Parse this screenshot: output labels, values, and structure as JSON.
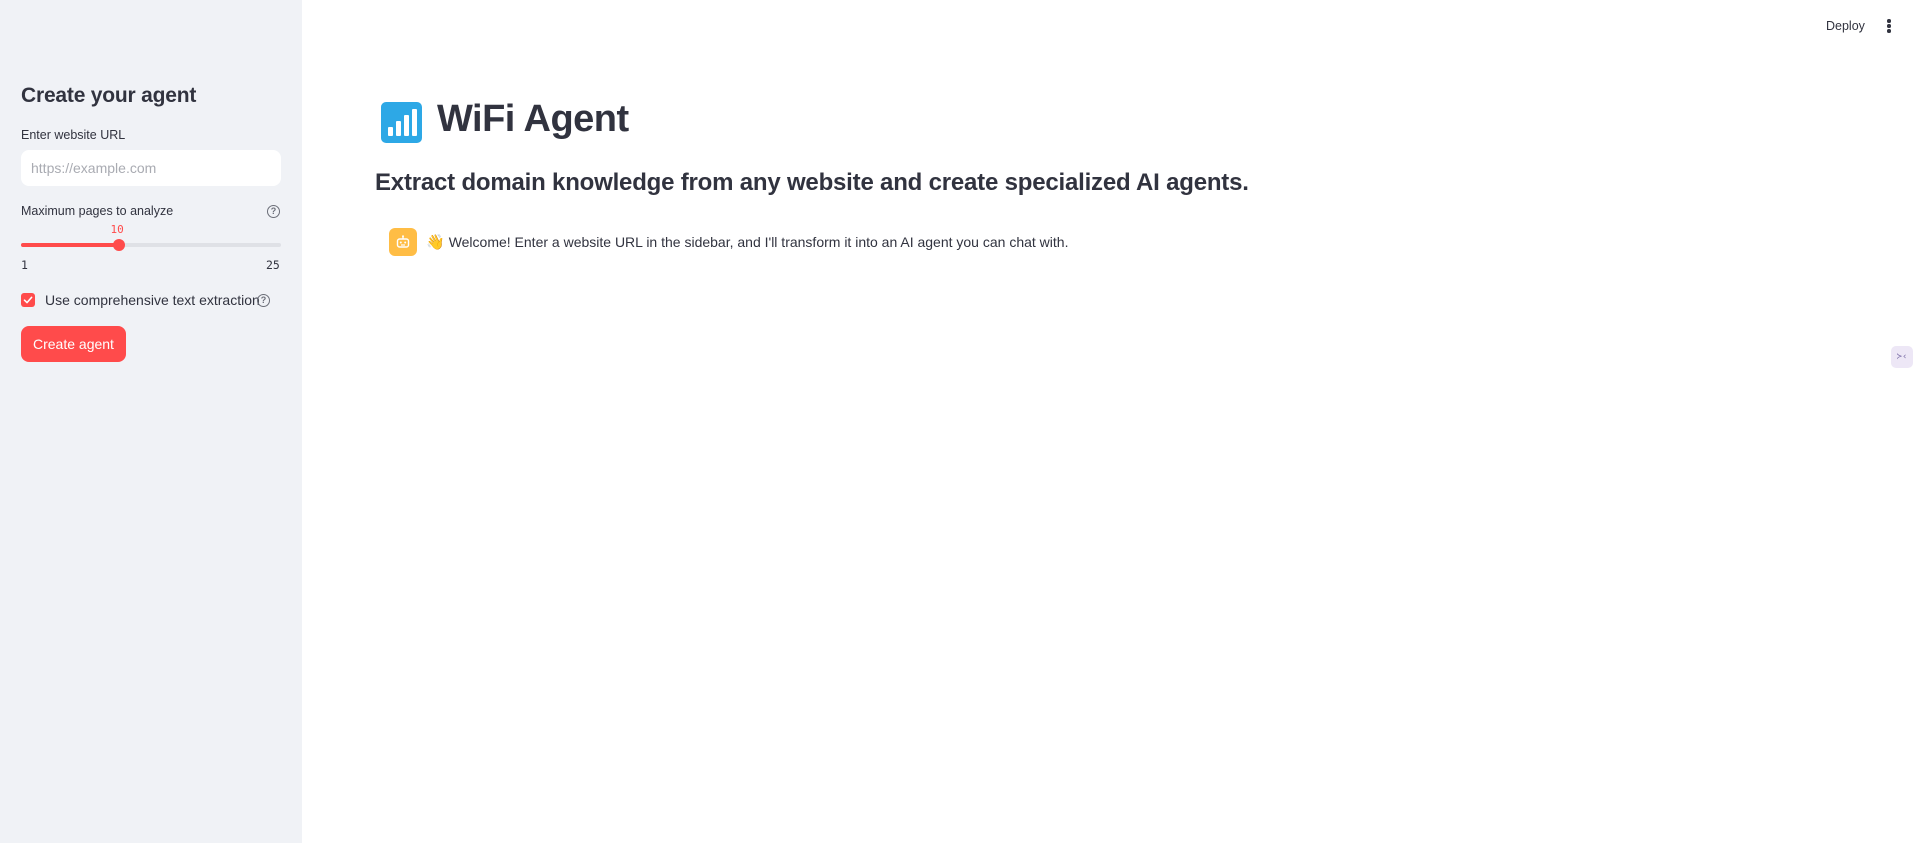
{
  "sidebar": {
    "title": "Create your agent",
    "url_label": "Enter website URL",
    "url_value": "",
    "url_placeholder": "https://example.com",
    "slider_label": "Maximum pages to analyze",
    "slider_value": "10",
    "slider_min": "1",
    "slider_max": "25",
    "checkbox_label": "Use comprehensive text extraction",
    "checkbox_checked": true,
    "create_button": "Create agent",
    "help_icon": "help-circle-icon"
  },
  "header": {
    "deploy_label": "Deploy",
    "menu_icon": "kebab-menu-icon"
  },
  "main": {
    "app_icon": "signal-bars-icon",
    "title": "WiFi Agent",
    "subtitle": "Extract domain knowledge from any website and create specialized AI agents.",
    "welcome_emoji": "👋",
    "welcome_text": "Welcome! Enter a website URL in the sidebar, and I'll transform it into an AI agent you can chat with.",
    "avatar_icon": "robot-icon"
  },
  "side_widget": "≻‹",
  "colors": {
    "accent": "#ff4b4b",
    "sidebar_bg": "#f0f2f6",
    "text": "#31333f",
    "avatar": "#ffbd45",
    "app_icon_bg": "#2da8e6"
  }
}
